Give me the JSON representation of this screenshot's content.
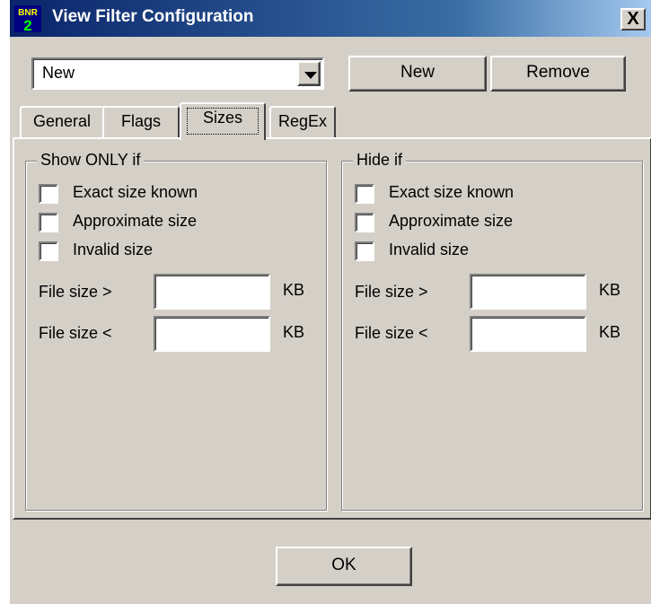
{
  "window": {
    "title": "View Filter Configuration",
    "close_label": "X",
    "icon_text_top": "BNR",
    "icon_text_bottom": "2"
  },
  "filter_select": {
    "value": "New"
  },
  "buttons": {
    "new_label": "New",
    "remove_label": "Remove",
    "ok_label": "OK"
  },
  "tabs": [
    {
      "label": "General"
    },
    {
      "label": "Flags"
    },
    {
      "label": "Sizes",
      "selected": true
    },
    {
      "label": "RegEx"
    }
  ],
  "show_group": {
    "title": "Show ONLY if",
    "checks": [
      {
        "label": "Exact size known",
        "checked": false
      },
      {
        "label": "Approximate size",
        "checked": false
      },
      {
        "label": "Invalid size",
        "checked": false
      }
    ],
    "size_gt_label": "File size >",
    "size_gt_value": "",
    "size_lt_label": "File size <",
    "size_lt_value": "",
    "unit": "KB"
  },
  "hide_group": {
    "title": "Hide if",
    "checks": [
      {
        "label": "Exact size known",
        "checked": false
      },
      {
        "label": "Approximate size",
        "checked": false
      },
      {
        "label": "Invalid size",
        "checked": false
      }
    ],
    "size_gt_label": "File size >",
    "size_gt_value": "",
    "size_lt_label": "File size <",
    "size_lt_value": "",
    "unit": "KB"
  },
  "colors": {
    "title_start": "#0a246a",
    "title_end": "#a6caf0",
    "face": "#d4d0c8"
  }
}
